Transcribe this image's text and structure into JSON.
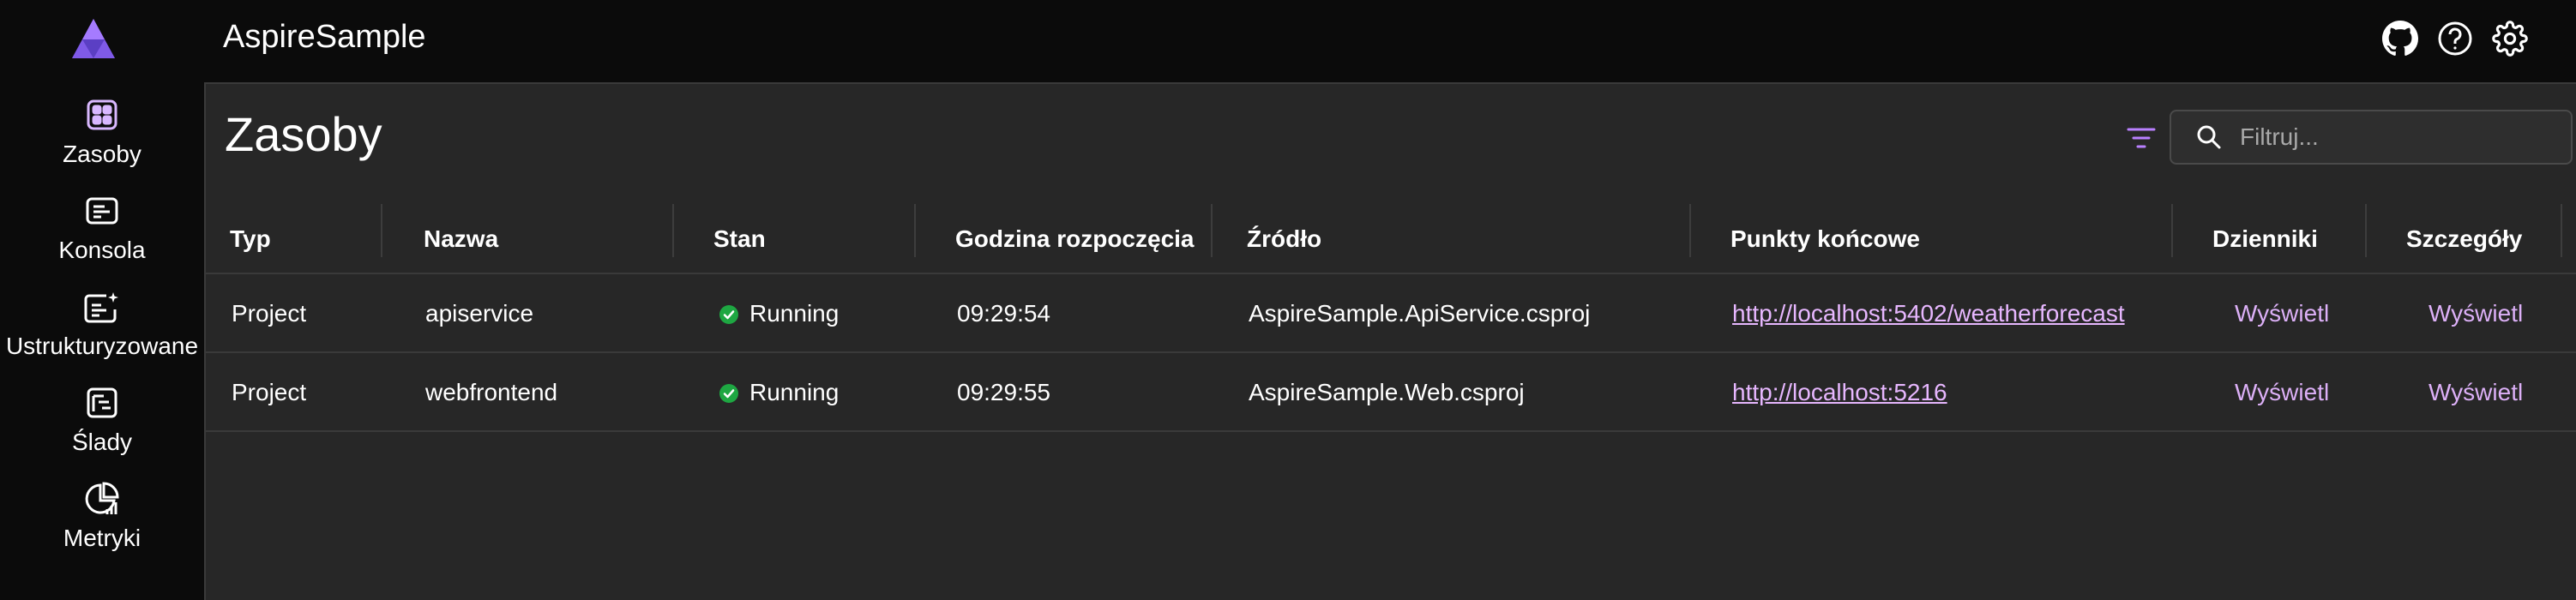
{
  "app": {
    "title": "AspireSample"
  },
  "colors": {
    "accent": "#b980ff",
    "link": "#e7b7ff",
    "success": "#1ea742",
    "panel_bg": "#272727",
    "app_bg": "#0b0b0b"
  },
  "sidebar": {
    "items": [
      {
        "label": "Zasoby",
        "icon": "resources-icon"
      },
      {
        "label": "Konsola",
        "icon": "console-icon"
      },
      {
        "label": "Ustrukturyzowane",
        "icon": "structured-logs-icon"
      },
      {
        "label": "Ślady",
        "icon": "traces-icon"
      },
      {
        "label": "Metryki",
        "icon": "metrics-icon"
      }
    ]
  },
  "header": {
    "icons": [
      "github-icon",
      "help-icon",
      "settings-icon"
    ]
  },
  "main": {
    "title": "Zasoby",
    "search": {
      "placeholder": "Filtruj...",
      "value": ""
    }
  },
  "table": {
    "columns": [
      "Typ",
      "Nazwa",
      "Stan",
      "Godzina rozpoczęcia",
      "Źródło",
      "Punkty końcowe",
      "Dzienniki",
      "Szczegóły"
    ],
    "rows": [
      {
        "type": "Project",
        "name": "apiservice",
        "state": "Running",
        "start_time": "09:29:54",
        "source": "AspireSample.ApiService.csproj",
        "endpoint": "http://localhost:5402/weatherforecast",
        "logs": "Wyświetl",
        "details": "Wyświetl"
      },
      {
        "type": "Project",
        "name": "webfrontend",
        "state": "Running",
        "start_time": "09:29:55",
        "source": "AspireSample.Web.csproj",
        "endpoint": "http://localhost:5216",
        "logs": "Wyświetl",
        "details": "Wyświetl"
      }
    ]
  }
}
